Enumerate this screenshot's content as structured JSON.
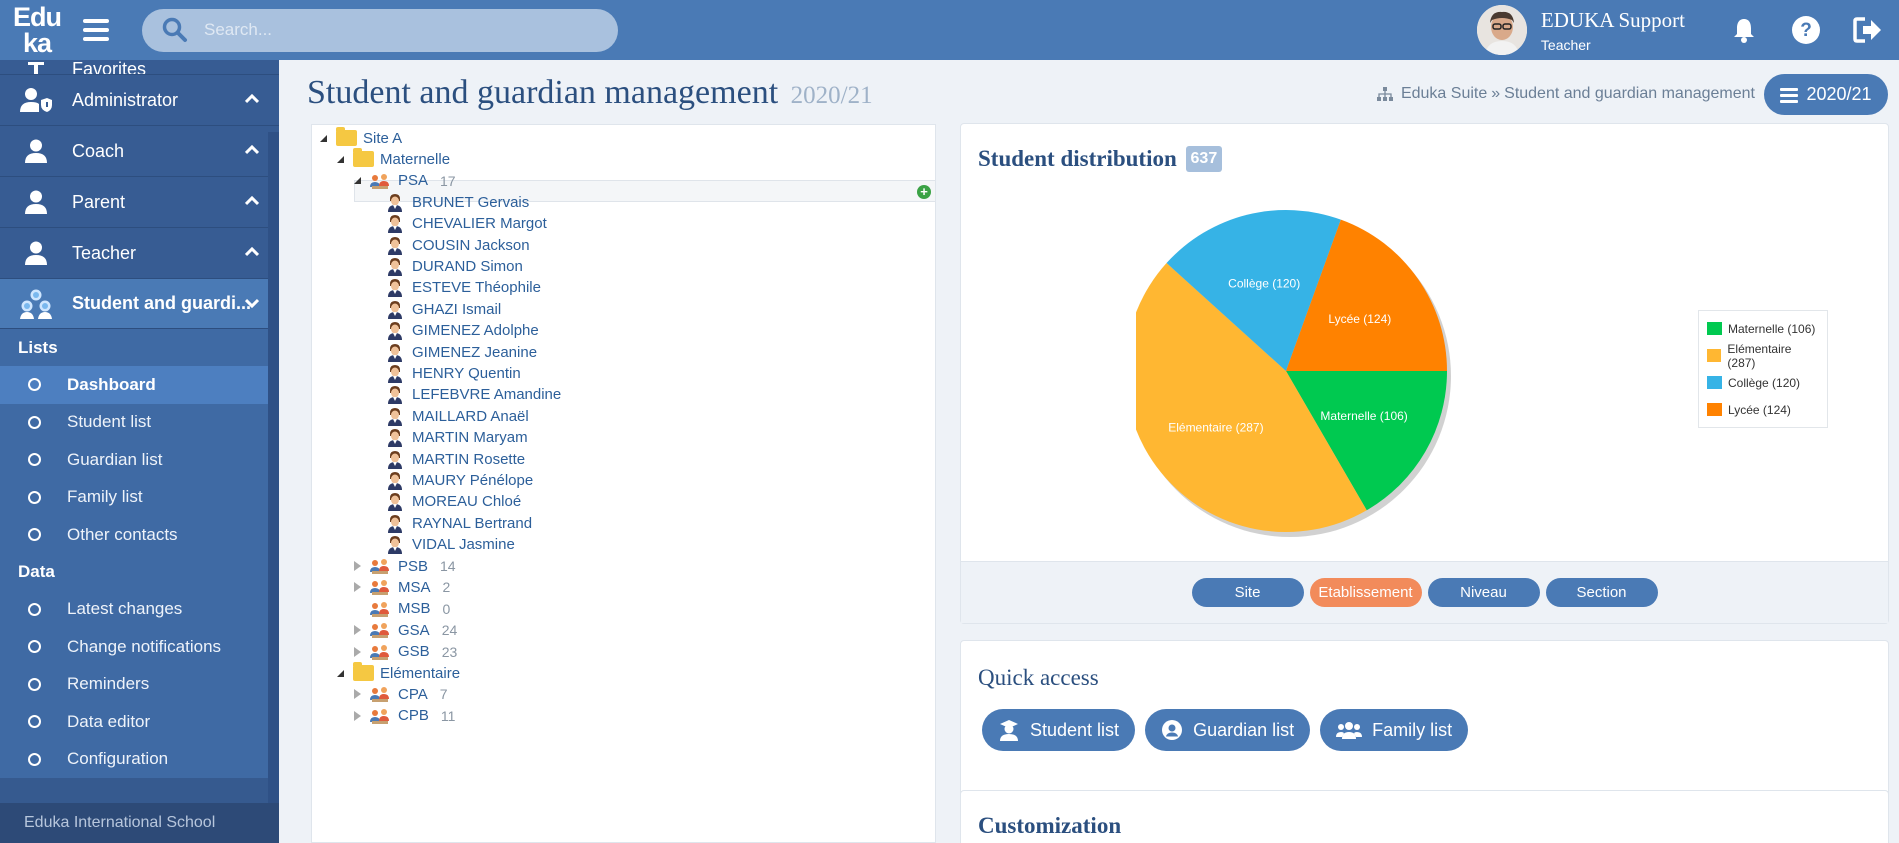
{
  "header": {
    "logo_line1": "Edu",
    "logo_line2": "ka",
    "search_placeholder": "Search...",
    "user_name": "EDUKA Support",
    "user_role": "Teacher"
  },
  "sidebar": {
    "partial_item": "Favorites",
    "roles": [
      {
        "label": "Administrator"
      },
      {
        "label": "Coach"
      },
      {
        "label": "Parent"
      },
      {
        "label": "Teacher"
      },
      {
        "label": "Student and guardi..."
      }
    ],
    "sections": [
      {
        "title": "Lists",
        "items": [
          "Dashboard",
          "Student list",
          "Guardian list",
          "Family list",
          "Other contacts"
        ]
      },
      {
        "title": "Data",
        "items": [
          "Latest changes",
          "Change notifications",
          "Reminders",
          "Data editor",
          "Configuration"
        ]
      }
    ],
    "footer": "Eduka International School"
  },
  "page": {
    "title": "Student and guardian management",
    "year": "2020/21",
    "breadcrumb_root": "Eduka Suite",
    "breadcrumb_sep": "»",
    "breadcrumb_current": "Student and guardian management",
    "year_button": "2020/21"
  },
  "tree": {
    "site": "Site A",
    "level1": "Maternelle",
    "open_group": {
      "name": "PSA",
      "count": "17"
    },
    "students": [
      "BRUNET Gervais",
      "CHEVALIER Margot",
      "COUSIN Jackson",
      "DURAND Simon",
      "ESTEVE Théophile",
      "GHAZI Ismail",
      "GIMENEZ Adolphe",
      "GIMENEZ Jeanine",
      "HENRY Quentin",
      "LEFEBVRE Amandine",
      "MAILLARD Anaël",
      "MARTIN Maryam",
      "MARTIN Rosette",
      "MAURY Pénélope",
      "MOREAU Chloé",
      "RAYNAL Bertrand",
      "VIDAL Jasmine"
    ],
    "groups": [
      {
        "name": "PSB",
        "count": "14",
        "expandable": true
      },
      {
        "name": "MSA",
        "count": "2",
        "expandable": true
      },
      {
        "name": "MSB",
        "count": "0",
        "expandable": false
      },
      {
        "name": "GSA",
        "count": "24",
        "expandable": true
      },
      {
        "name": "GSB",
        "count": "23",
        "expandable": true
      }
    ],
    "level2": "Elémentaire",
    "groups2": [
      {
        "name": "CPA",
        "count": "7"
      },
      {
        "name": "CPB",
        "count": "11"
      }
    ]
  },
  "distribution": {
    "title": "Student distribution",
    "total": "637",
    "filters": [
      {
        "label": "Site",
        "active": false
      },
      {
        "label": "Etablissement",
        "active": true
      },
      {
        "label": "Niveau",
        "active": false
      },
      {
        "label": "Section",
        "active": false
      }
    ]
  },
  "chart_data": {
    "type": "pie",
    "slices": [
      {
        "label": "Maternelle (106)",
        "legend": "Maternelle (106)",
        "value": 106,
        "color": "#00c950"
      },
      {
        "label": "Elémentaire (287)",
        "legend": "Elémentaire (287)",
        "value": 287,
        "color": "#ffb732"
      },
      {
        "label": "Collège (120)",
        "legend": "Collège (120)",
        "value": 120,
        "color": "#36b3e6"
      },
      {
        "label": "Lycée (124)",
        "legend": "Lycée (124)",
        "value": 124,
        "color": "#ff8200"
      }
    ],
    "legend_position": "right"
  },
  "quick_access": {
    "title": "Quick access",
    "buttons": [
      "Student list",
      "Guardian list",
      "Family list"
    ]
  },
  "customization": {
    "title": "Customization"
  }
}
